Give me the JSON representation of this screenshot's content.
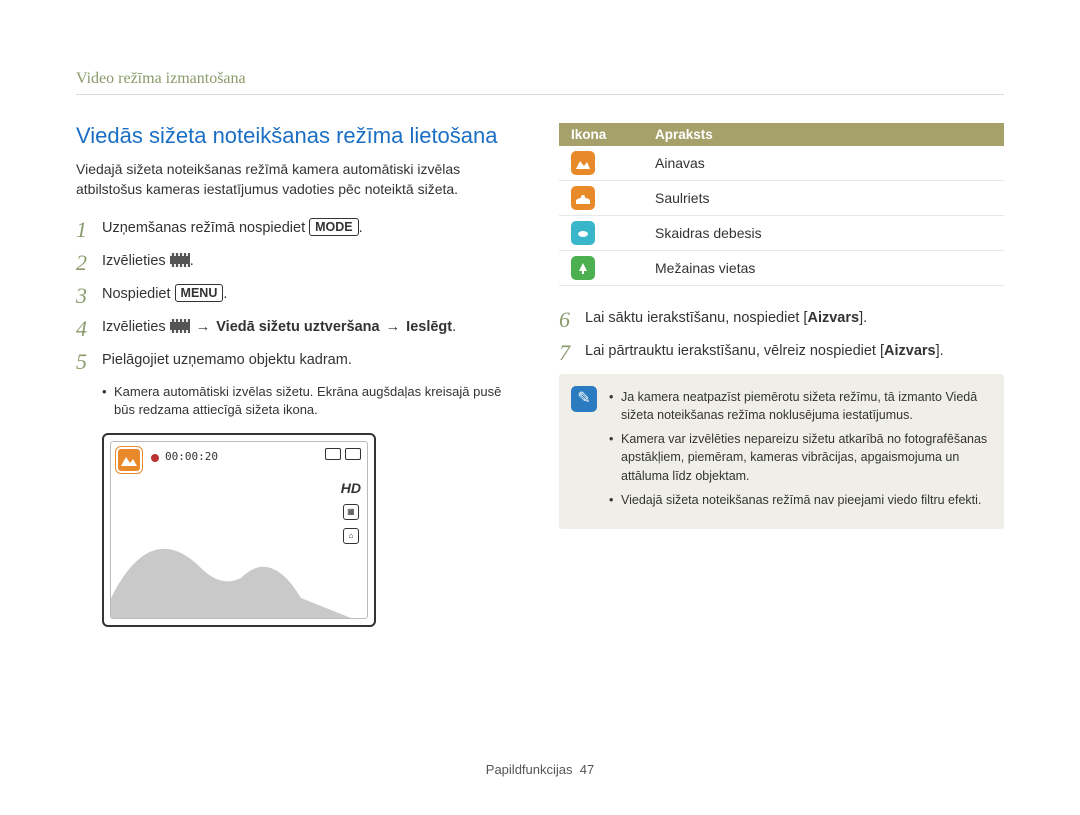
{
  "breadcrumb": "Video režīma izmantošana",
  "section_title": "Viedās sižeta noteikšanas režīma lietošana",
  "intro": "Viedajā sižeta noteikšanas režīmā kamera automātiski izvēlas atbilstošus kameras iestatījumus vadoties pēc noteiktā sižeta.",
  "steps": {
    "s1_pre": "Uzņemšanas režīmā nospiediet ",
    "s1_btn": "MODE",
    "s1_post": ".",
    "s2_pre": "Izvēlieties ",
    "s2_post": ".",
    "s3_pre": "Nospiediet ",
    "s3_btn": "MENU",
    "s3_post": ".",
    "s4_pre": "Izvēlieties ",
    "s4_arrow1": " → ",
    "s4_b1": "Viedā sižetu uztveršana",
    "s4_arrow2": " → ",
    "s4_b2": "Ieslēgt",
    "s4_post": ".",
    "s5": "Pielāgojiet uzņemamo objektu kadram.",
    "s5_sub": "Kamera automātiski izvēlas sižetu. Ekrāna augšdaļas kreisajā pusē būs redzama attiecīgā sižeta ikona.",
    "s6_pre": "Lai sāktu ierakstīšanu, nospiediet [",
    "s6_b": "Aizvars",
    "s6_post": "].",
    "s7_pre": "Lai pārtrauktu ierakstīšanu, vēlreiz nospiediet [",
    "s7_b": "Aizvars",
    "s7_post": "]."
  },
  "screen": {
    "timer": "00:00:20",
    "hd": "HD"
  },
  "table": {
    "h_icon": "Ikona",
    "h_desc": "Apraksts",
    "rows": [
      {
        "color": "sq-orange",
        "label": "Ainavas"
      },
      {
        "color": "sq-orange",
        "label": "Saulriets"
      },
      {
        "color": "sq-teal",
        "label": "Skaidras debesis"
      },
      {
        "color": "sq-green",
        "label": "Mežainas vietas"
      }
    ]
  },
  "notes": [
    "Ja kamera neatpazīst piemērotu sižeta režīmu, tā izmanto Viedā sižeta noteikšanas režīma noklusējuma iestatījumus.",
    "Kamera var izvēlēties nepareizu sižetu atkarībā no fotografēšanas apstākļiem, piemēram, kameras vibrācijas, apgaismojuma un attāluma līdz objektam.",
    "Viedajā sižeta noteikšanas režīmā nav pieejami viedo filtru efekti."
  ],
  "footer_label": "Papildfunkcijas",
  "footer_page": "47"
}
